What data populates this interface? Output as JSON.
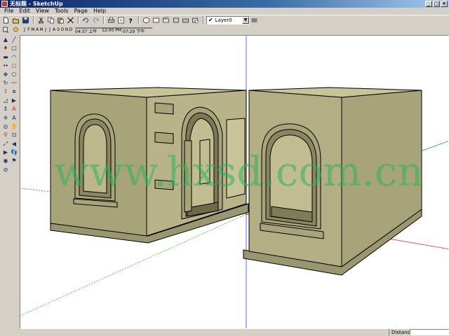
{
  "window": {
    "title": "无标题 - SketchUp"
  },
  "menu": [
    "File",
    "Edit",
    "View",
    "Tools",
    "Page",
    "Help"
  ],
  "shadow_settings": {
    "months": [
      "J",
      "F",
      "M",
      "A",
      "M",
      "J",
      "J",
      "A",
      "S",
      "O",
      "N",
      "D"
    ],
    "sunrise": "04:37 上午",
    "noon": "12:00 PM",
    "sunset": "07:29 下午"
  },
  "layers": {
    "current": "Layer0"
  },
  "toolbar_icons": [
    "new-icon",
    "open-icon",
    "save-icon",
    "print-icon",
    "cut-icon",
    "copy-icon",
    "paste-icon",
    "erase-icon",
    "undo-icon",
    "redo-icon",
    "print-preview-icon",
    "model-info-icon",
    "help-icon",
    "iso-view-icon",
    "top-view-icon",
    "front-view-icon",
    "right-view-icon",
    "back-view-icon",
    "left-view-icon",
    "layers-icon"
  ],
  "left_tools": [
    "select",
    "line",
    "paint",
    "rectangle",
    "eraser",
    "arc",
    "tape",
    "circle",
    "move",
    "polygon",
    "rotate",
    "freehand",
    "push-pull",
    "offset",
    "protractor",
    "follow-me",
    "dimension",
    "text",
    "axes",
    "3d-text",
    "orbit",
    "pan",
    "zoom",
    "zoom-window",
    "zoom-extents",
    "previous",
    "next",
    "walk",
    "look-around",
    "position-camera",
    "section"
  ],
  "watermark": "www.hxsd.com.cn",
  "status": {
    "label": "Distance",
    "value": ""
  },
  "colors": {
    "wall": "#a8a47a",
    "wall_dark": "#8a865f",
    "wall_light": "#c2bd91",
    "edge": "#000000"
  }
}
